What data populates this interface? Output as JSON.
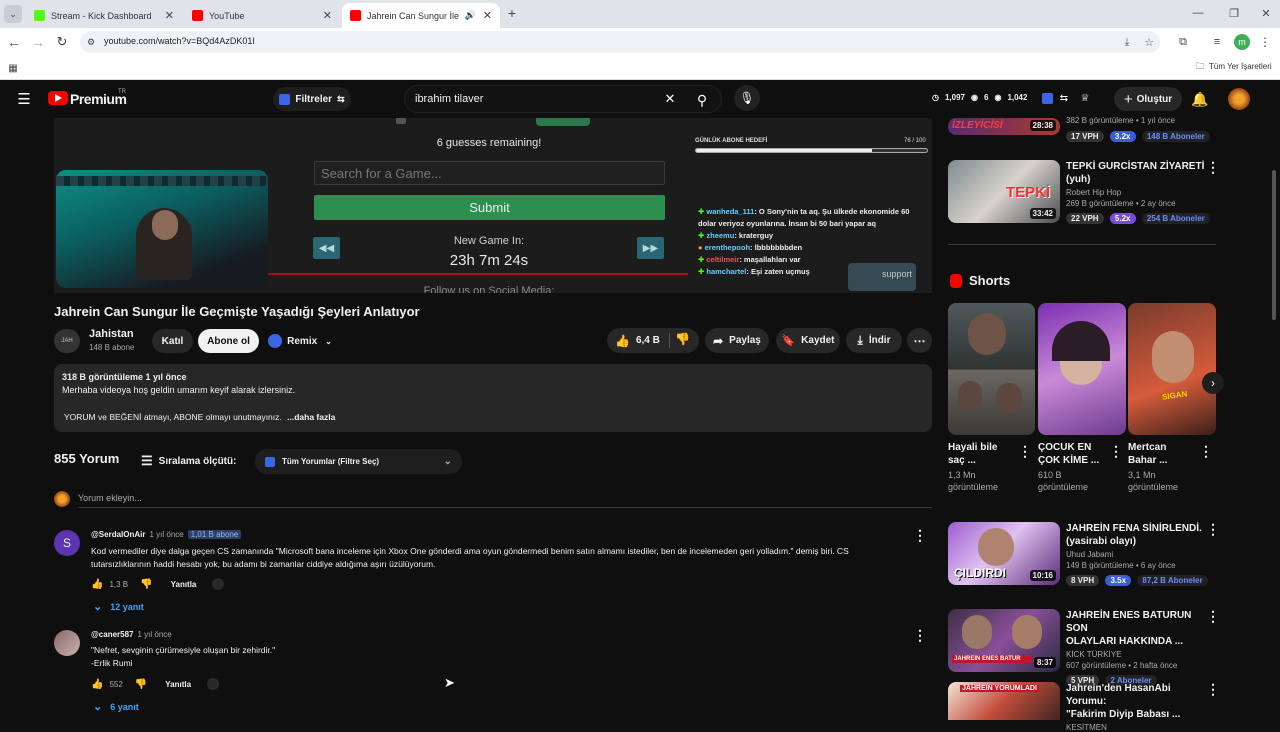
{
  "browser": {
    "tabs": [
      {
        "title": "Stream - Kick Dashboard",
        "color": "#53fc18"
      },
      {
        "title": "YouTube",
        "color": "#ff0000"
      },
      {
        "title": "Jahrein Can Sungur İle Geç",
        "color": "#ff0000"
      }
    ],
    "url": "youtube.com/watch?v=BQd4AzDK01I",
    "bookmarks_label": "Tüm Yer İşaretleri",
    "profile_letter": "m"
  },
  "yt": {
    "logo": "Premium",
    "logo_sup": "TR",
    "filters_label": "Filtreler",
    "search_value": "ibrahim tilaver",
    "stats": {
      "a": "1,097",
      "b": "6",
      "c": "1,042"
    },
    "create_label": "Oluştur"
  },
  "player": {
    "guesses": "6 guesses remaining!",
    "search_placeholder": "Search for a Game...",
    "submit": "Submit",
    "new_game_label": "New Game In:",
    "timer": "23h 7m 24s",
    "follow": "Follow us on Social Media:",
    "goal_label": "GÜNLÜK ABONE HEDEFİ",
    "goal_value": "76 / 100",
    "goal_fraction": 0.76,
    "chat": [
      {
        "user": "wanheda_111",
        "msg": ": O Sony'nin ta aq. Şu ülkede ekonomide 60 dolar veriyoz oyunlarına. İnsan bi 50 bari yapar aq"
      },
      {
        "user": "zheemu",
        "msg": ": kraterguy"
      },
      {
        "user": "erenthepooh",
        "msg": ": lbbbbbbbden"
      },
      {
        "user": "celtilmeir",
        "msg": ": maşallahları var"
      },
      {
        "user": "hamchartel",
        "msg": ": Eşi zaten uçmuş"
      }
    ],
    "support": "support"
  },
  "video": {
    "title": "Jahrein Can Sungur İle Geçmişte Yaşadığı Şeyleri Anlatıyor",
    "channel": "Jahistan",
    "subs": "148 B abone",
    "join": "Katıl",
    "subscribe": "Abone ol",
    "remix": "Remix",
    "likes": "6,4 B",
    "share": "Paylaş",
    "save": "Kaydet",
    "download": "İndir"
  },
  "description": {
    "views_time": "318 B görüntüleme  1 yıl önce",
    "line1": "Merhaba videoya hoş geldin umarım keyif alarak izlersiniz.",
    "line2": "YORUM ve BEĞENİ atmayı, ABONE olmayı unutmayınız.",
    "more": "...daha fazla"
  },
  "comments": {
    "count": "855 Yorum",
    "sort_label": "Sıralama ölçütü:",
    "filter": "Tüm Yorumlar (Filtre Seç)",
    "add_placeholder": "Yorum ekleyin...",
    "reply_label": "Yanıtla",
    "items": [
      {
        "avatar": "S",
        "user": "@SerdalOnAir",
        "time": "1 yıl önce",
        "badge": "1,01 B abone",
        "text1": "Kod vermediler diye dalga geçen CS zamanında \"Microsoft bana inceleme için Xbox One gönderdi ama oyun göndermedi benim satın almamı istediler, ben de incelemeden geri yolladım.\" demiş biri. CS",
        "text2": "tutarsızlıklarının haddi hesabı yok, bu adamı bi zamanlar ciddiye aldığıma aşırı üzülüyorum.",
        "likes": "1,3 B",
        "replies": "12 yanıt"
      },
      {
        "avatar": "",
        "user": "@caner587",
        "time": "1 yıl önce",
        "badge": "",
        "text1": "\"Nefret, sevginin çürümesiyle oluşan bir zehirdir.\"",
        "text2": "-Erlik Rumi",
        "likes": "552",
        "replies": "6 yanıt"
      }
    ]
  },
  "sidebar": {
    "top_partial": {
      "views": "382 B görüntüleme • 1 yıl önce",
      "vph": "17 VPH",
      "mult": "3.2x",
      "subs": "148 B Aboneler",
      "dur": "28:38",
      "thumb_text": "İZLEYİCİSİ"
    },
    "shorts_title": "Shorts",
    "videos": [
      {
        "title1": "TEPKİ GURCİSTAN ZİYARETİ",
        "title2": "(yuh)",
        "channel": "Robert Hip Hop",
        "views": "269 B görüntüleme • 2 ay önce",
        "vph": "22 VPH",
        "mult": "5.2x",
        "subs": "254 B Aboneler",
        "dur": "33:42",
        "thumb_text": "TEPKİ"
      },
      {
        "title1": "JAHREİN FENA SİNİRLENDİ.",
        "title2": "(yasirabi olayı)",
        "channel": "Uhud Jabami",
        "views": "149 B görüntüleme • 6 ay önce",
        "vph": "8 VPH",
        "mult": "3.5x",
        "subs": "87,2 B Aboneler",
        "dur": "10:16",
        "thumb_text": "ÇILDIRDI"
      },
      {
        "title1": "JAHREİN ENES BATURUN SON",
        "title2": "OLAYLARI HAKKINDA ...",
        "channel": "KİCK TÜRKİYE",
        "views": "607 görüntüleme • 2 hafta önce",
        "vph": "5 VPH",
        "mult": "",
        "subs": "2 Aboneler",
        "dur": "8:37",
        "thumb_text": "JAHREIN ENES BATUR"
      },
      {
        "title1": "Jahrein'den HasanAbi Yorumu:",
        "title2": "\"Fakirim Diyip Babası ...",
        "channel": "KESİTMEN",
        "views": "",
        "vph": "",
        "mult": "",
        "subs": "",
        "dur": "",
        "thumb_text": "JAHREIN YORUMLADI"
      }
    ],
    "shorts": [
      {
        "title1": "Hayali bile",
        "title2": "saç ...",
        "views1": "1,3 Mn",
        "views2": "görüntüleme"
      },
      {
        "title1": "ÇOCUK EN",
        "title2": "ÇOK KİME ...",
        "views1": "610 B",
        "views2": "görüntüleme"
      },
      {
        "title1": "Mertcan",
        "title2": "Bahar ...",
        "views1": "3,1 Mn",
        "views2": "görüntüleme"
      }
    ],
    "short3_text": "SIGAN"
  }
}
